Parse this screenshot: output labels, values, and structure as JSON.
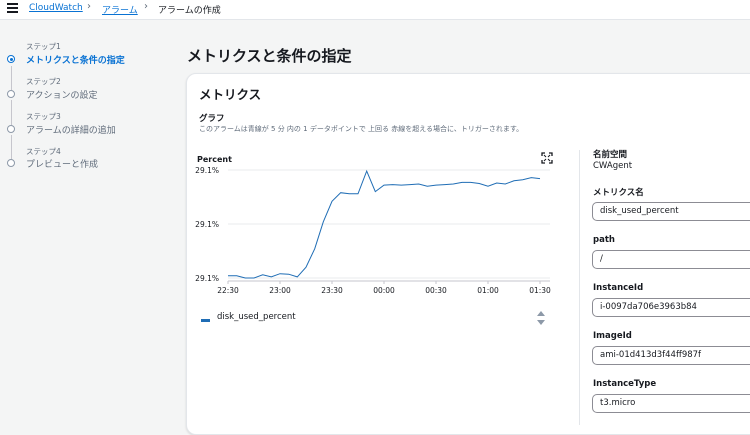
{
  "breadcrumb": {
    "items": [
      {
        "label": "CloudWatch"
      },
      {
        "label": "アラーム"
      },
      {
        "label": "アラームの作成"
      }
    ]
  },
  "wizard": {
    "steps": [
      {
        "number": "ステップ1",
        "label": "メトリクスと条件の指定",
        "active": true
      },
      {
        "number": "ステップ2",
        "label": "アクションの設定",
        "active": false
      },
      {
        "number": "ステップ3",
        "label": "アラームの詳細の追加",
        "active": false
      },
      {
        "number": "ステップ4",
        "label": "プレビューと作成",
        "active": false
      }
    ]
  },
  "page": {
    "title": "メトリクスと条件の指定"
  },
  "metrics_panel": {
    "title": "メトリクス",
    "graph_heading": "グラフ",
    "graph_description": "このアラームは青線が 5 分 内の 1 データポイントで 上回る 赤線を超える場合に、トリガーされます。",
    "unit_label": "Percent",
    "legend_label": "disk_used_percent"
  },
  "chart_data": {
    "type": "line",
    "ylabel": "Percent",
    "y_tick_labels": [
      "29.1%",
      "29.1%",
      "29.1%"
    ],
    "x_tick_labels": [
      "22:30",
      "23:00",
      "23:30",
      "00:00",
      "00:30",
      "01:00",
      "01:30"
    ],
    "series": [
      {
        "name": "disk_used_percent",
        "color": "#1f6db5",
        "x": [
          "22:30",
          "22:35",
          "22:40",
          "22:45",
          "22:50",
          "22:55",
          "23:00",
          "23:05",
          "23:10",
          "23:15",
          "23:20",
          "23:25",
          "23:30",
          "23:35",
          "23:40",
          "23:45",
          "23:50",
          "23:55",
          "00:00",
          "00:05",
          "00:10",
          "00:15",
          "00:20",
          "00:25",
          "00:30",
          "00:35",
          "00:40",
          "00:45",
          "00:50",
          "00:55",
          "01:00",
          "01:05",
          "01:10",
          "01:15",
          "01:20",
          "01:25",
          "01:30"
        ],
        "values": [
          0.02,
          0.02,
          0.0,
          0.0,
          0.03,
          0.01,
          0.04,
          0.035,
          0.01,
          0.1,
          0.27,
          0.52,
          0.71,
          0.79,
          0.78,
          0.78,
          0.99,
          0.8,
          0.86,
          0.865,
          0.86,
          0.865,
          0.87,
          0.85,
          0.86,
          0.865,
          0.87,
          0.885,
          0.885,
          0.875,
          0.85,
          0.88,
          0.87,
          0.9,
          0.91,
          0.93,
          0.92
        ]
      }
    ]
  },
  "fields": {
    "namespace_label": "名前空間",
    "namespace_value": "CWAgent",
    "metric_name_label": "メトリクス名",
    "metric_name_value": "disk_used_percent",
    "path_label": "path",
    "path_value": "/",
    "instance_id_label": "InstanceId",
    "instance_id_value": "i-0097da706e3963b84",
    "image_id_label": "ImageId",
    "image_id_value": "ami-01d413d3f44ff987f",
    "instance_type_label": "InstanceType",
    "instance_type_value": "t3.micro"
  },
  "colors": {
    "accent": "#0972d3",
    "series_line": "#1f6db5"
  },
  "icons": [
    "menu-icon",
    "chevron-right-icon",
    "expand-icon",
    "sort-icon"
  ]
}
